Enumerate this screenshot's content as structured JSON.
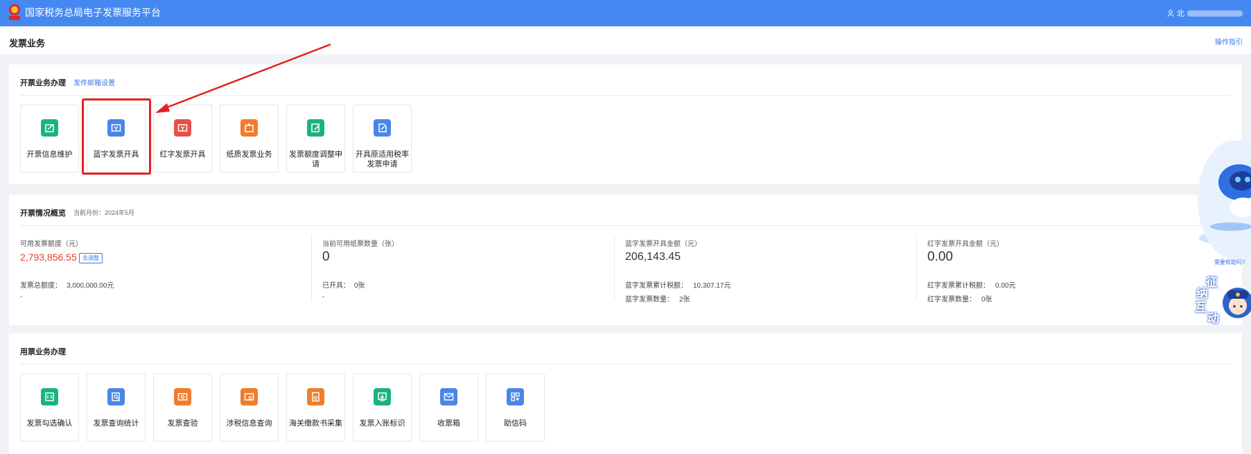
{
  "header": {
    "app_title": "国家税务总局电子发票服务平台",
    "user_text": "北"
  },
  "page": {
    "title": "发票业务",
    "guide_link": "操作指引"
  },
  "invoice_issue": {
    "title": "开票业务办理",
    "mail_setting": "发件邮箱设置",
    "tiles": [
      {
        "label": "开票信息维护",
        "icon": "edit-doc-icon",
        "color": "#1ab47a"
      },
      {
        "label": "蓝字发票开具",
        "icon": "ticket-icon",
        "color": "#4a86e8"
      },
      {
        "label": "红字发票开具",
        "icon": "ticket-icon",
        "color": "#e5514a"
      },
      {
        "label": "纸质发票业务",
        "icon": "paper-icon",
        "color": "#f07d2c"
      },
      {
        "label": "发票额度调整申请",
        "icon": "pen-doc-icon",
        "color": "#1ab47a"
      },
      {
        "label": "开具原适用税率发票申请",
        "icon": "doc-icon",
        "color": "#4a86e8"
      }
    ]
  },
  "overview": {
    "title": "开票情况概览",
    "month_label": "当前月份：2024年5月",
    "available_quota_label": "可用发票额度（元）",
    "available_quota_value": "2,793,856.55",
    "adjust_badge": "去调整",
    "total_quota_label": "发票总额度：",
    "total_quota_value": "3,000,000.00元",
    "total_quota_extra": "-",
    "paper_count_label": "当前可用纸票数量（张）",
    "paper_count_value": "0",
    "issued_label": "已开具：",
    "issued_value": "0张",
    "issued_extra": "-",
    "blue_amount_label": "蓝字发票开具金额（元）",
    "blue_amount_value": "206,143.45",
    "blue_tax_label": "蓝字发票累计税额：",
    "blue_tax_value": "10,307.17元",
    "blue_count_label": "蓝字发票数量：",
    "blue_count_value": "2张",
    "red_amount_label": "红字发票开具金额（元）",
    "red_amount_value": "0.00",
    "red_tax_label": "红字发票累计税额：",
    "red_tax_value": "0.00元",
    "red_count_label": "红字发票数量：",
    "red_count_value": "0张"
  },
  "invoice_use": {
    "title": "用票业务办理",
    "tiles": [
      {
        "label": "发票勾选确认",
        "icon": "check-doc-icon",
        "color": "#1ab47a"
      },
      {
        "label": "发票查询统计",
        "icon": "search-doc-icon",
        "color": "#4a86e8"
      },
      {
        "label": "发票查验",
        "icon": "verify-icon",
        "color": "#f07d2c"
      },
      {
        "label": "涉税信息查询",
        "icon": "search-card-icon",
        "color": "#f07d2c"
      },
      {
        "label": "海关缴款书采集",
        "icon": "customs-doc-icon",
        "color": "#f07d2c"
      },
      {
        "label": "发票入账标识",
        "icon": "stamp-icon",
        "color": "#1ab47a"
      },
      {
        "label": "收票箱",
        "icon": "mailbox-icon",
        "color": "#4a86e8"
      },
      {
        "label": "助信码",
        "icon": "qr-icon",
        "color": "#4a86e8"
      }
    ]
  },
  "assistant": {
    "hint": "需要帮助吗?",
    "interact": "征纳互动"
  }
}
